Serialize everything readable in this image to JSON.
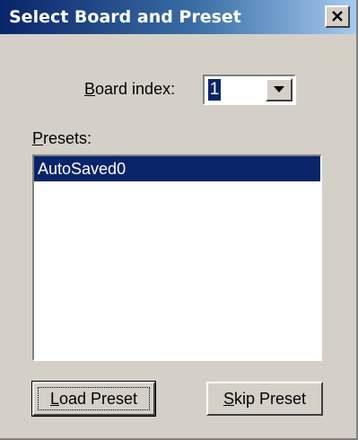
{
  "window": {
    "title": "Select Board and Preset",
    "close_icon": "close-icon"
  },
  "board": {
    "label_accel": "B",
    "label_rest": "oard index:",
    "value": "1",
    "dropdown_icon": "chevron-down-icon"
  },
  "presets": {
    "label_accel": "P",
    "label_rest": "resets:",
    "items": [
      {
        "label": "AutoSaved0",
        "selected": true
      }
    ]
  },
  "buttons": {
    "load_accel": "L",
    "load_rest": "oad Preset",
    "skip_accel": "S",
    "skip_rest": "kip Preset"
  },
  "colors": {
    "selection": "#0a246a",
    "dialog_bg": "#d4d0c8"
  }
}
